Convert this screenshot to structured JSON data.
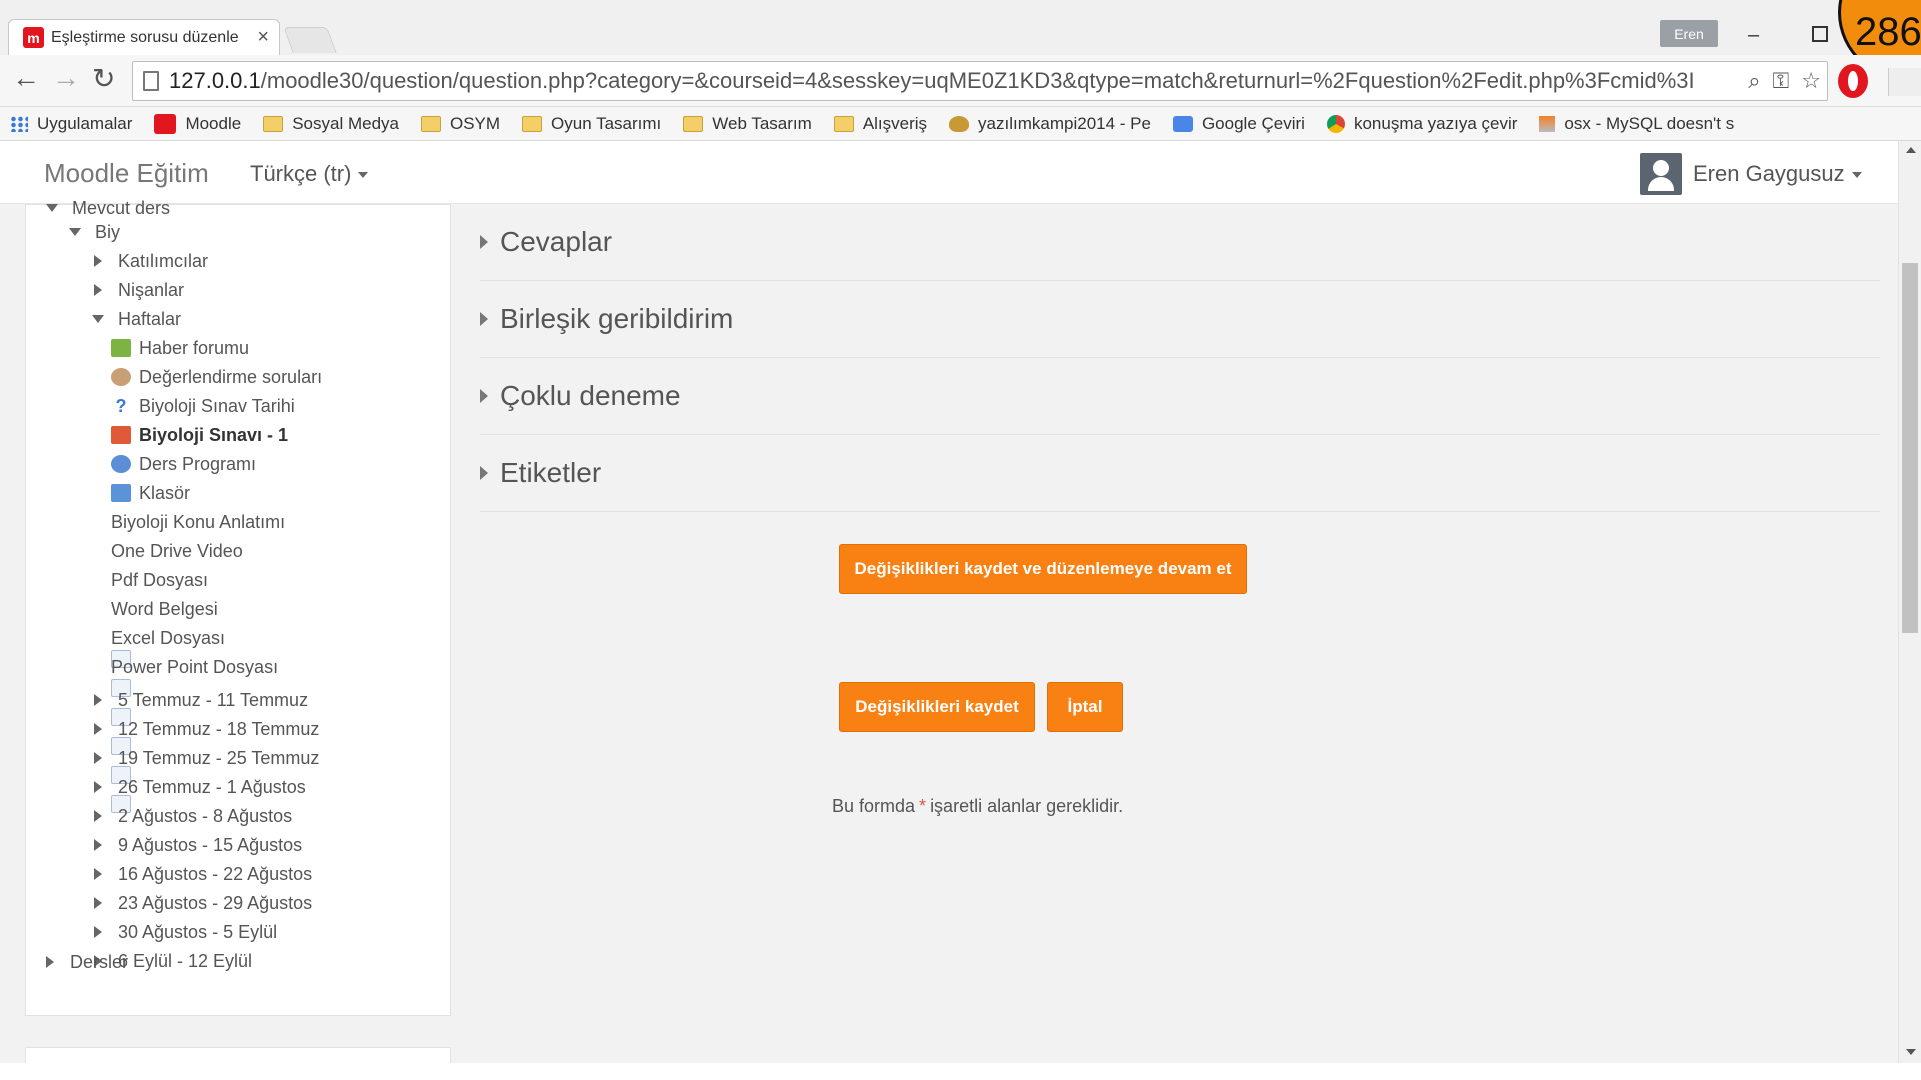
{
  "browser": {
    "tab_title": "Eşleştirme sorusu düzenle",
    "tab_close": "×",
    "profile_name": "Eren",
    "minimize_glyph": "–",
    "corner_number": "286",
    "url_host": "127.0.0.1",
    "url_path": "/moodle30/question/question.php?category=&courseid=4&sesskey=uqME0Z1KD3&qtype=match&returnurl=%2Fquestion%2Fedit.php%3Fcmid%3I",
    "back_glyph": "←",
    "forward_glyph": "→",
    "reload_glyph": "↻",
    "zoom_glyph": "⌕",
    "key_glyph": "⚿",
    "star_glyph": "☆"
  },
  "bookmarks": [
    {
      "label": "Uygulamalar",
      "icon": "apps-icon"
    },
    {
      "label": "Moodle",
      "icon": "moodle-icon"
    },
    {
      "label": "Sosyal Medya",
      "icon": "folder-icon"
    },
    {
      "label": "OSYM",
      "icon": "folder-icon"
    },
    {
      "label": "Oyun Tasarımı",
      "icon": "folder-icon"
    },
    {
      "label": "Web Tasarım",
      "icon": "folder-icon"
    },
    {
      "label": "Alışveriş",
      "icon": "folder-icon"
    },
    {
      "label": "yazılımkampi2014 - Pe",
      "icon": "lion-icon"
    },
    {
      "label": "Google Çeviri",
      "icon": "translate-icon"
    },
    {
      "label": "konuşma yazıya çevir",
      "icon": "chrome-icon"
    },
    {
      "label": "osx - MySQL doesn't s",
      "icon": "stackoverflow-icon"
    }
  ],
  "navbar": {
    "brand": "Moodle Eğitim",
    "language": "Türkçe (tr)",
    "user_name": "Eren Gaygusuz"
  },
  "tree": {
    "mevcut": "Mevcut ders",
    "course": "Biy",
    "katilimcilar": "Katılımcılar",
    "nisanlar": "Nişanlar",
    "haftalar": "Haftalar",
    "activities": [
      "Haber forumu",
      "Değerlendirme soruları",
      "Biyoloji Sınav Tarihi",
      "Biyoloji Sınavı - 1",
      "Ders Programı",
      "Klasör",
      "Biyoloji Konu Anlatımı",
      "One Drive Video",
      "Pdf Dosyası",
      "Word Belgesi",
      "Excel Dosyası",
      "Power Point Dosyası"
    ],
    "weeks": [
      "5 Temmuz - 11 Temmuz",
      "12 Temmuz - 18 Temmuz",
      "19 Temmuz - 25 Temmuz",
      "26 Temmuz - 1 Ağustos",
      "2 Ağustos - 8 Ağustos",
      "9 Ağustos - 15 Ağustos",
      "16 Ağustos - 22 Ağustos",
      "23 Ağustos - 29 Ağustos",
      "30 Ağustos - 5 Eylül",
      "6 Eylül - 12 Eylül"
    ],
    "dersler": "Dersler"
  },
  "form": {
    "sections": [
      "Cevaplar",
      "Birleşik geribildirim",
      "Çoklu deneme",
      "Etiketler"
    ],
    "save_continue": "Değişiklikleri kaydet ve düzenlemeye devam et",
    "save": "Değişiklikleri kaydet",
    "cancel": "İptal",
    "required_before": "Bu formda",
    "required_star": "*",
    "required_after": "işaretli alanlar gereklidir."
  }
}
